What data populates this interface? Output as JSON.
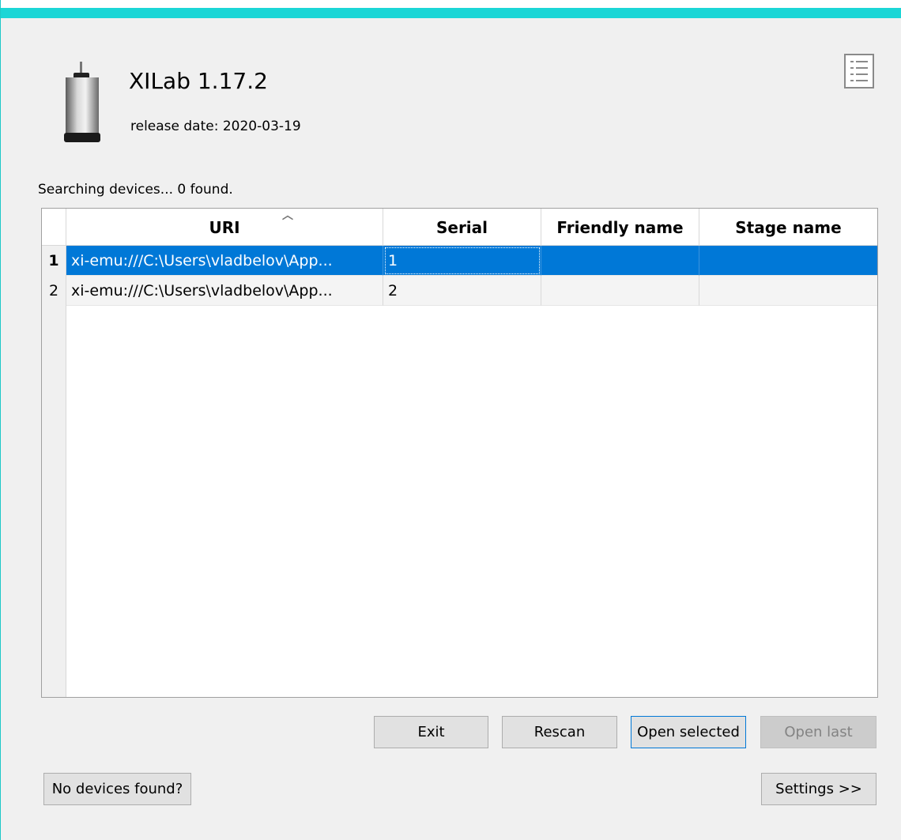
{
  "app": {
    "title": "XILab 1.17.2",
    "release": "release date: 2020-03-19"
  },
  "status": "Searching devices... 0 found.",
  "table": {
    "columns": [
      "URI",
      "Serial",
      "Friendly name",
      "Stage name"
    ],
    "rows": [
      {
        "num": "1",
        "uri": "xi-emu:///C:\\Users\\vladbelov\\App...",
        "serial": "1",
        "friendly": "",
        "stage": "",
        "selected": true
      },
      {
        "num": "2",
        "uri": "xi-emu:///C:\\Users\\vladbelov\\App...",
        "serial": "2",
        "friendly": "",
        "stage": "",
        "selected": false
      }
    ]
  },
  "buttons": {
    "exit": "Exit",
    "rescan": "Rescan",
    "open_selected": "Open selected",
    "open_last": "Open last",
    "no_devices": "No devices found?",
    "settings": "Settings >>"
  },
  "icons": {
    "motor": "stepper-motor-icon",
    "log": "log-document-icon"
  },
  "colors": {
    "accent_bar": "#1cd6d6",
    "selection": "#0078d7"
  }
}
